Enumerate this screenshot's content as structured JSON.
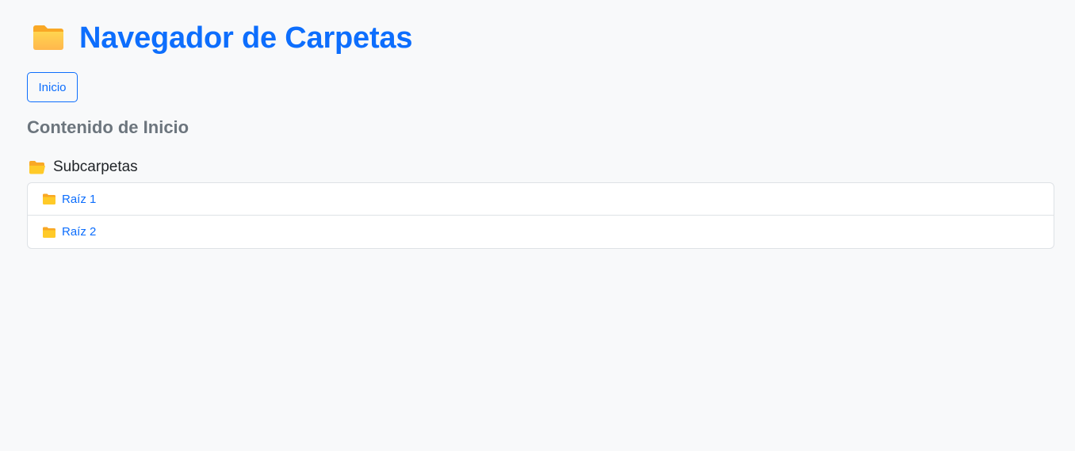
{
  "page": {
    "title": "Navegador de Carpetas",
    "title_icon": "folder-icon"
  },
  "breadcrumb": {
    "items": [
      {
        "label": "Inicio"
      }
    ]
  },
  "content": {
    "heading": "Contenido de Inicio",
    "subfolders_label": "Subcarpetas",
    "subfolders_icon": "open-folder-icon",
    "folders": [
      {
        "label": "Raíz 1",
        "icon": "folder-icon"
      },
      {
        "label": "Raíz 2",
        "icon": "folder-icon"
      }
    ]
  },
  "colors": {
    "accent": "#0d6efd",
    "background": "#f8f9fa",
    "muted_text": "#6c757d",
    "folder_yellow": "#ffca28"
  }
}
